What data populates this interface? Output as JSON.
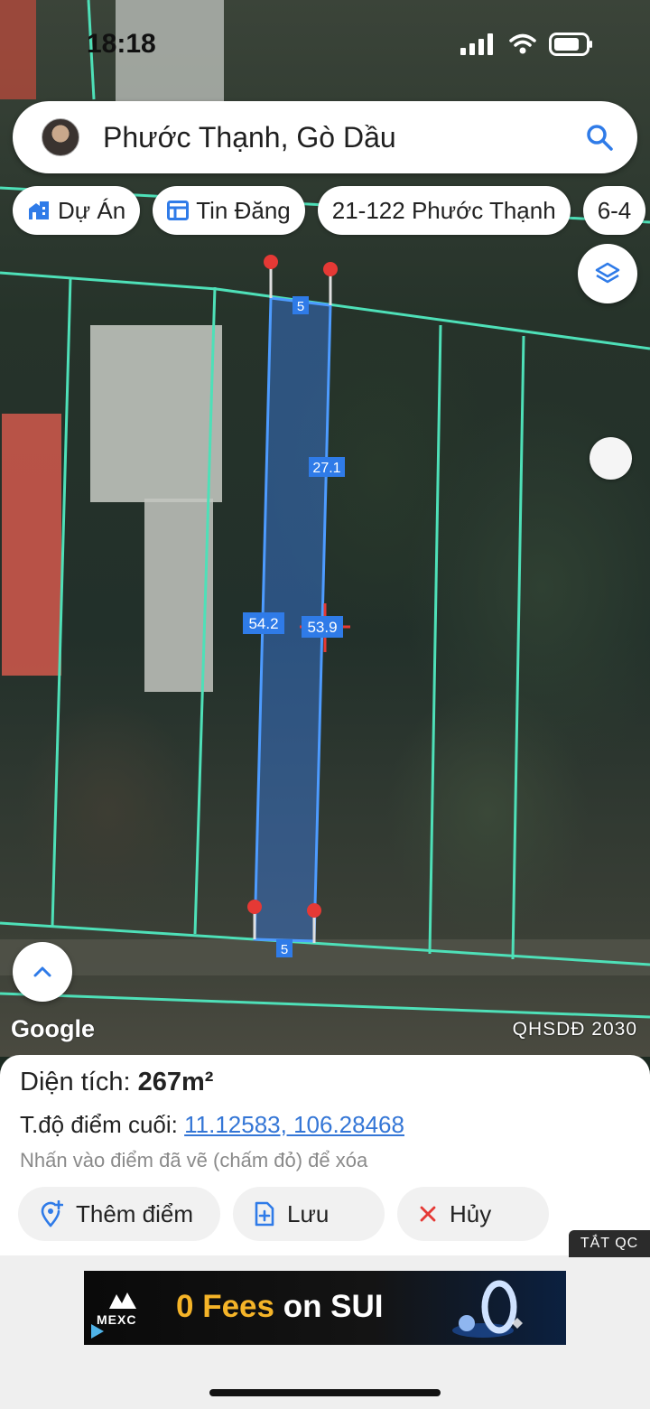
{
  "status_bar": {
    "time": "18:18"
  },
  "search": {
    "text": "Phước Thạnh, Gò Dầu"
  },
  "chips": [
    {
      "label": "Dự Án",
      "icon": "project-icon"
    },
    {
      "label": "Tin Đăng",
      "icon": "listing-icon"
    },
    {
      "label": "21-122 Phước Thạnh",
      "icon": ""
    },
    {
      "label": "6-4",
      "icon": ""
    }
  ],
  "map": {
    "logo": "Google",
    "layer_label": "QHSDĐ 2030",
    "measurements": {
      "top_edge": "5",
      "bottom_edge": "5",
      "left_edge": "54.2",
      "right_edge": "53.9",
      "right_upper": "27.1"
    },
    "colors": {
      "parcel_line": "#4ee0b8",
      "selection": "#3b82f6",
      "marker": "#e53935"
    }
  },
  "panel": {
    "area_label": "Diện tích:",
    "area_value": "267m²",
    "coord_label": "T.độ điểm cuối:",
    "coord_value": "11.12583, 106.28468",
    "hint": "Nhấn vào điểm đã vẽ (chấm đỏ) để xóa",
    "buttons": {
      "add": "Thêm điểm",
      "save": "Lưu",
      "cancel": "Hủy"
    }
  },
  "ad": {
    "close_label": "TẮT QC",
    "brand": "MEXC",
    "headline_highlight": "0 Fees",
    "headline_rest": "on SUI"
  }
}
